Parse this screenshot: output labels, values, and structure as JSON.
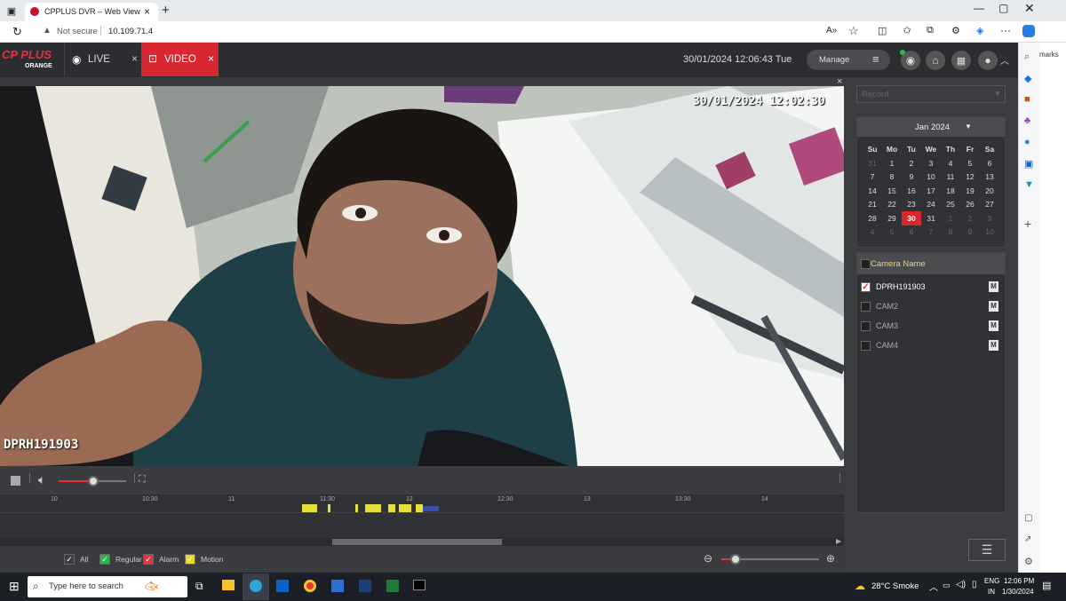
{
  "browser": {
    "tab_title": "CPPLUS DVR – Web View",
    "security_label": "Not secure",
    "url": "10.109.71.4",
    "side_text": "marks"
  },
  "app": {
    "logo_text": "CP PLUS",
    "logo_sub": "ORANGE",
    "tabs": [
      {
        "label": "LIVE"
      },
      {
        "label": "VIDEO"
      }
    ],
    "datetime": "30/01/2024 12:06:43 Tue",
    "manage_label": "Manage"
  },
  "video": {
    "osd_timestamp": "30/01/2024 12:02:30",
    "osd_camera": "DPRH191903"
  },
  "timeline": {
    "ticks": [
      "10",
      "10:30",
      "11",
      "11:30",
      "12",
      "12:30",
      "13",
      "13:30",
      "14"
    ],
    "legend": [
      {
        "label": "All",
        "color": "#3b3d41"
      },
      {
        "label": "Regular",
        "color": "#2fb24a"
      },
      {
        "label": "Alarm",
        "color": "#e5323b"
      },
      {
        "label": "Motion",
        "color": "#e8d82a"
      }
    ]
  },
  "sidebar": {
    "record_select": "Record",
    "calendar": {
      "month": "Jan 2024",
      "weekdays": [
        "Su",
        "Mo",
        "Tu",
        "We",
        "Th",
        "Fr",
        "Sa"
      ],
      "rows": [
        [
          "31",
          "1",
          "2",
          "3",
          "4",
          "5",
          "6"
        ],
        [
          "7",
          "8",
          "9",
          "10",
          "11",
          "12",
          "13"
        ],
        [
          "14",
          "15",
          "16",
          "17",
          "18",
          "19",
          "20"
        ],
        [
          "21",
          "22",
          "23",
          "24",
          "25",
          "26",
          "27"
        ],
        [
          "28",
          "29",
          "30",
          "31",
          "1",
          "2",
          "3"
        ],
        [
          "4",
          "5",
          "6",
          "7",
          "8",
          "9",
          "10"
        ]
      ],
      "selected": "30"
    },
    "camera_header": "Camera Name",
    "cameras": [
      {
        "name": "DPRH191903",
        "checked": true,
        "badge": "M"
      },
      {
        "name": "CAM2",
        "checked": false,
        "badge": "M"
      },
      {
        "name": "CAM3",
        "checked": false,
        "badge": "M"
      },
      {
        "name": "CAM4",
        "checked": false,
        "badge": "M"
      }
    ]
  },
  "taskbar": {
    "search_placeholder": "Type here to search",
    "weather": "28°C  Smoke",
    "lang_top": "ENG",
    "lang_bottom": "IN",
    "time": "12:06 PM",
    "date": "1/30/2024"
  }
}
